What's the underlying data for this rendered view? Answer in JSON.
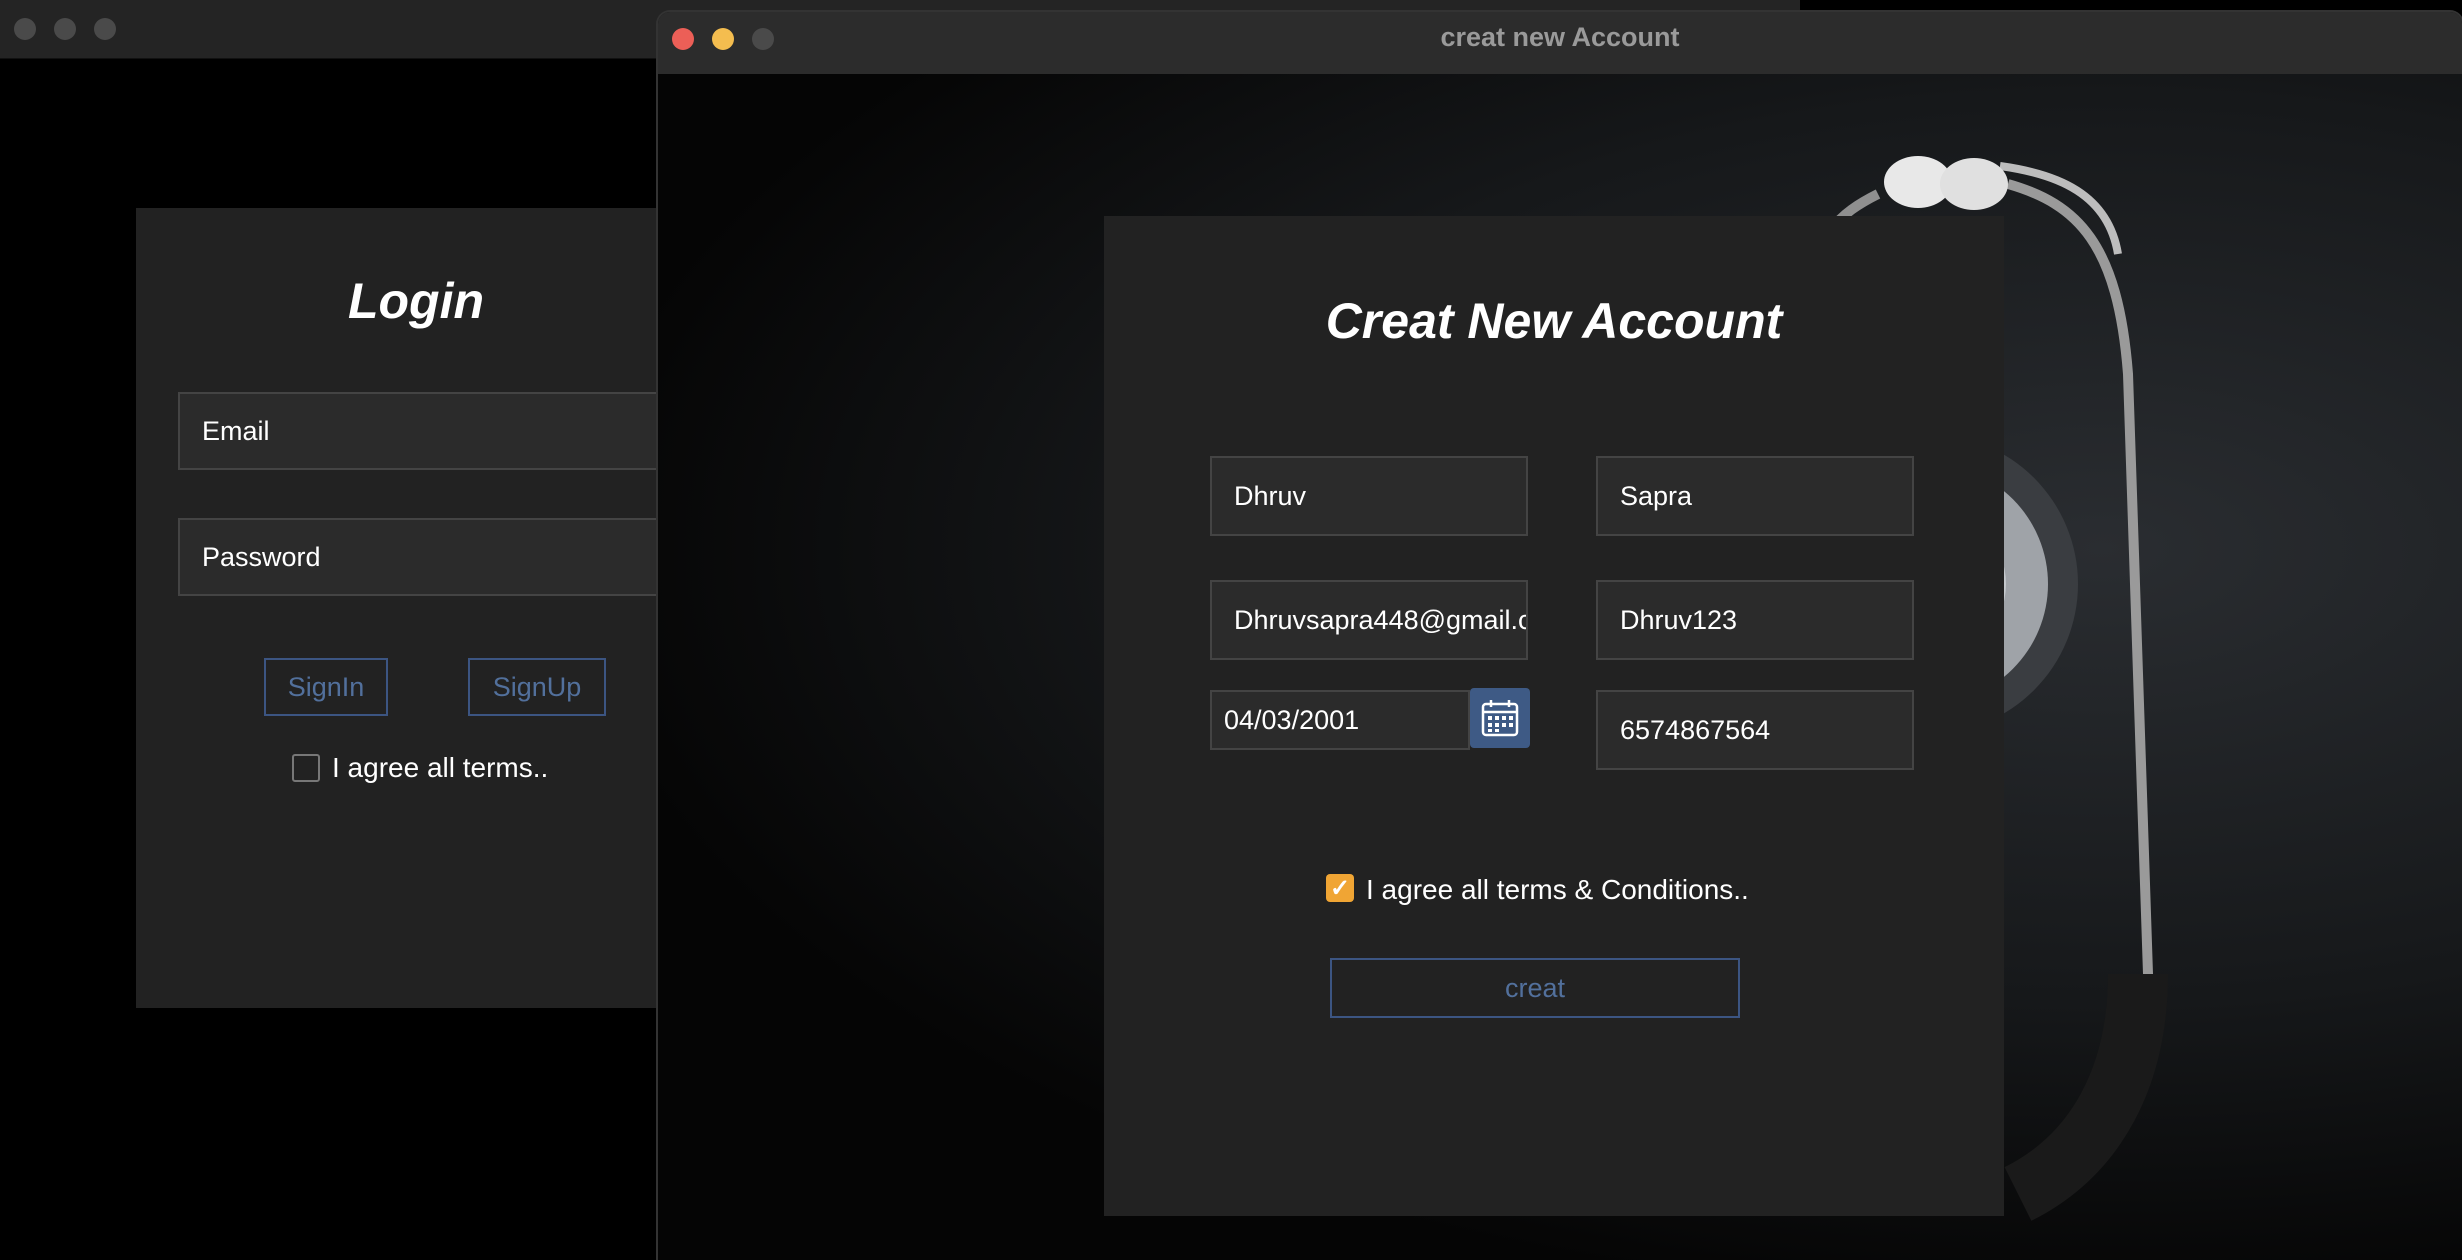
{
  "login_window": {
    "title": "Login",
    "email_placeholder": "Email",
    "password_placeholder": "Password",
    "signin_label": "SignIn",
    "signup_label": "SignUp",
    "agree_label": "I agree all terms.."
  },
  "signup_window": {
    "window_title": "creat new Account",
    "form_title": "Creat New Account",
    "first_name": "Dhruv",
    "last_name": "Sapra",
    "email": "Dhruvsapra448@gmail.c",
    "username": "Dhruv123",
    "dob": "04/03/2001",
    "phone": "6574867564",
    "agree_label": "I agree all terms & Conditions..",
    "agree_checked": true,
    "create_label": "creat"
  },
  "colors": {
    "close": "#ec5f57",
    "minimize": "#f4bd4f",
    "accent_button": "#3e5a85",
    "checkbox_checked": "#f0a534"
  }
}
